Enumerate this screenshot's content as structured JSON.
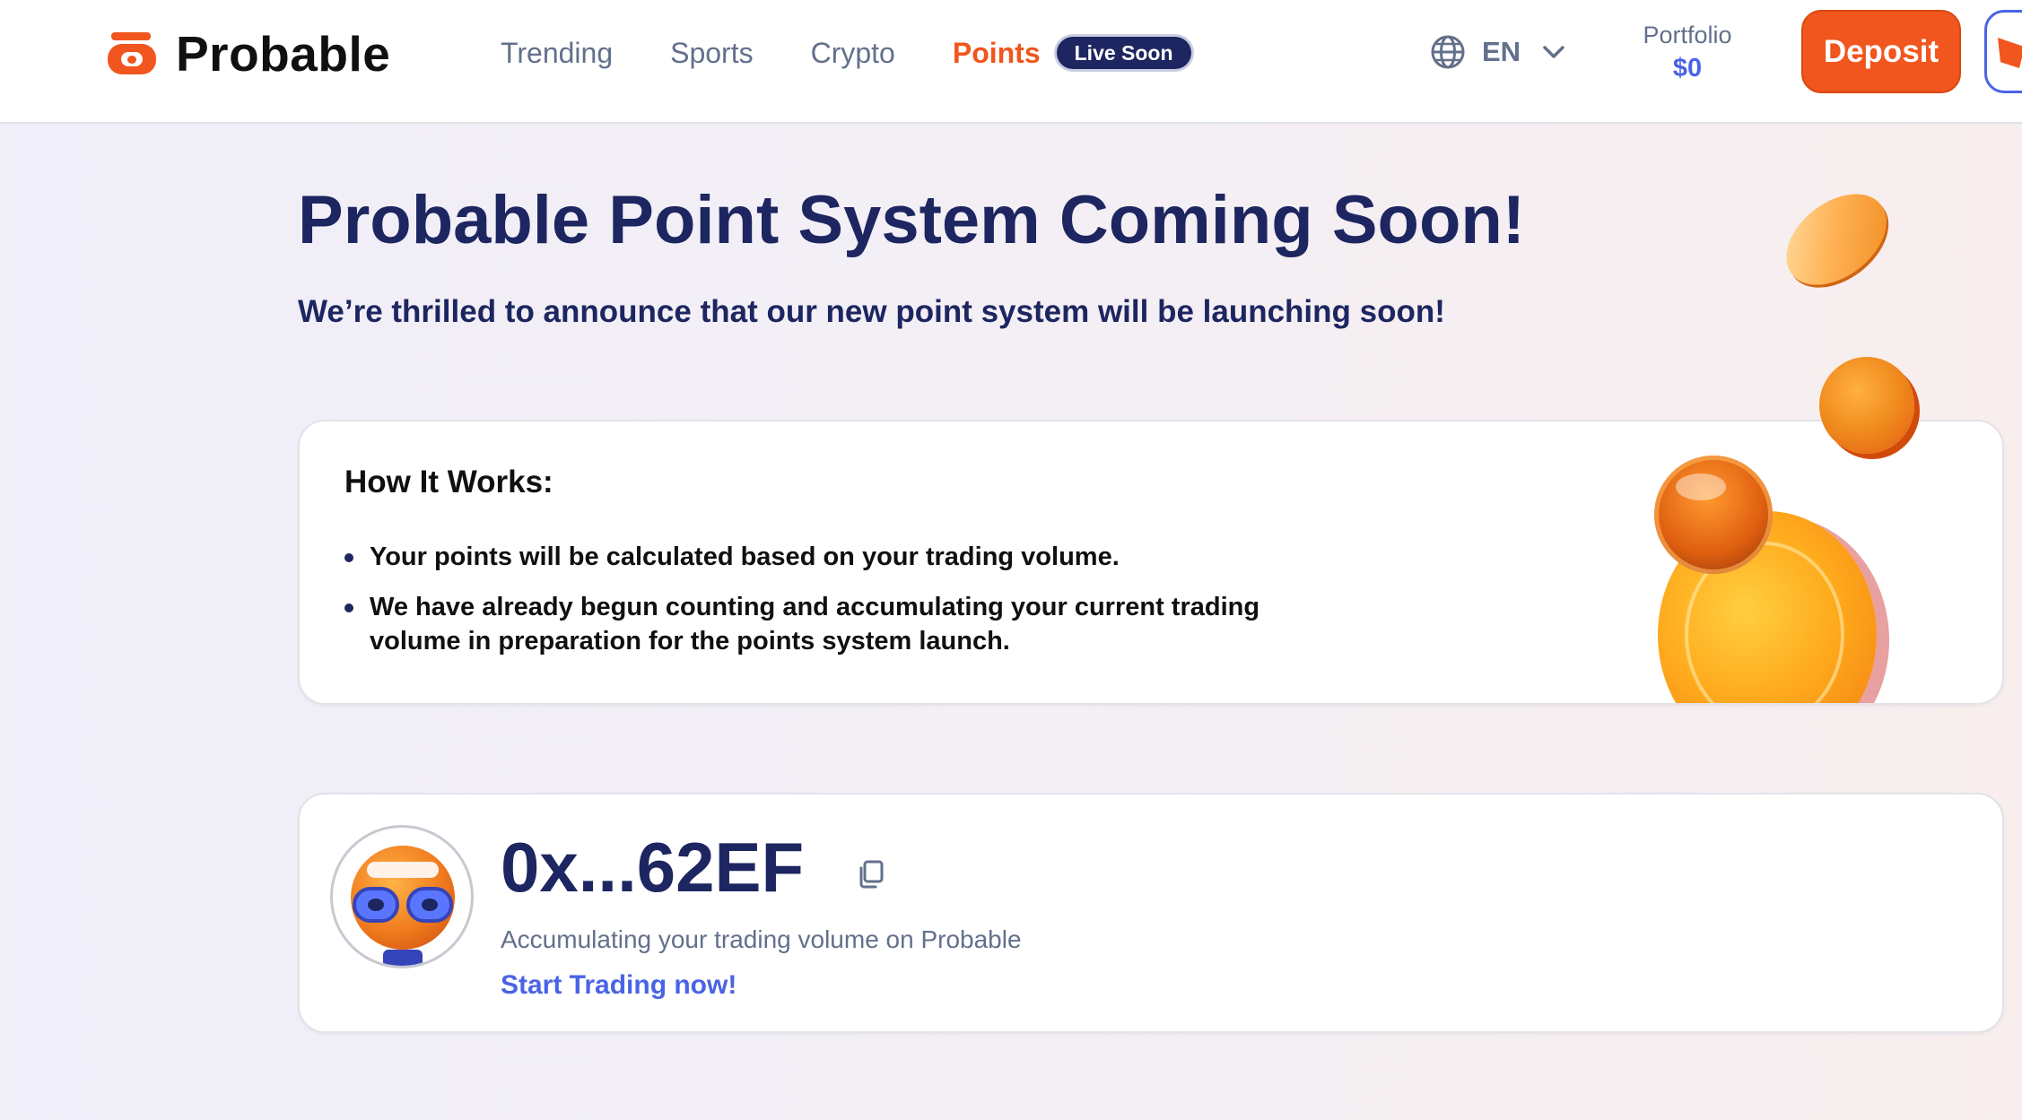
{
  "brand": {
    "name": "Probable"
  },
  "nav": {
    "items": [
      {
        "label": "Trending"
      },
      {
        "label": "Sports"
      },
      {
        "label": "Crypto"
      },
      {
        "label": "Points"
      }
    ],
    "points_badge": "Live Soon"
  },
  "language": {
    "label": "EN"
  },
  "portfolio": {
    "label": "Portfolio",
    "value": "$0"
  },
  "actions": {
    "deposit_label": "Deposit"
  },
  "hero": {
    "title": "Probable Point System Coming Soon!",
    "subtitle": "We’re thrilled to announce that our new point system will be launching soon!"
  },
  "how_it_works": {
    "heading": "How It Works:",
    "bullets": [
      "Your points will be calculated based on your trading volume.",
      "We have already begun counting and accumulating your current trading volume in preparation for the points system launch."
    ]
  },
  "user": {
    "address": "0x...62EF",
    "status": "Accumulating your trading volume on Probable",
    "cta": "Start Trading now!"
  },
  "colors": {
    "brand_orange": "#f0561d",
    "navy": "#1d2660",
    "link_blue": "#4a63e6",
    "muted_text": "#63708c"
  },
  "icons": [
    "globe-icon",
    "chevron-down-icon",
    "copy-icon",
    "metamask-fox-icon"
  ]
}
